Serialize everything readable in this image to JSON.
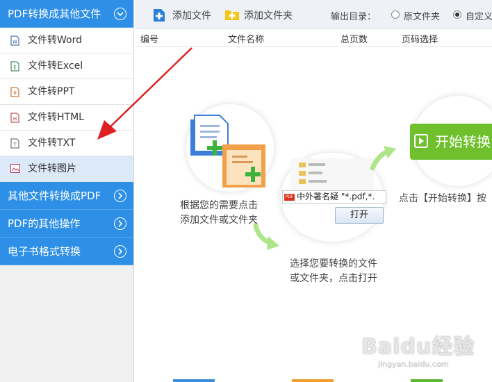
{
  "sidebar": {
    "header1": "PDF转换成其他文件",
    "items": [
      {
        "label": "文件转Word",
        "icon": "word-file-icon",
        "color": "#2b5797",
        "letter": "W"
      },
      {
        "label": "文件转Excel",
        "icon": "excel-file-icon",
        "color": "#217346",
        "letter": "E"
      },
      {
        "label": "文件转PPT",
        "icon": "ppt-file-icon",
        "color": "#c55a11",
        "letter": "P"
      },
      {
        "label": "文件转HTML",
        "icon": "html-file-icon",
        "color": "#a33",
        "letter": "H"
      },
      {
        "label": "文件转TXT",
        "icon": "txt-file-icon",
        "color": "#555",
        "letter": "T"
      },
      {
        "label": "文件转图片",
        "icon": "image-file-icon",
        "color": "#c03060",
        "letter": ""
      }
    ],
    "header2": "其他文件转换成PDF",
    "header3": "PDF的其他操作",
    "header4": "电子书格式转换"
  },
  "toolbar": {
    "add_file": "添加文件",
    "add_folder": "添加文件夹",
    "output_label": "输出目录：",
    "radio_original": "原文件夹",
    "radio_custom": "自定义"
  },
  "table": {
    "columns": [
      "编号",
      "文件名称",
      "总页数",
      "页码选择"
    ]
  },
  "guide": {
    "step1": [
      "根据您的需要点击",
      "添加文件或文件夹"
    ],
    "step2": [
      "选择您要转换的文件",
      "或文件夹，点击打开"
    ],
    "step3": "点击【开始转换】按",
    "start_label": "开始转换",
    "dialog_filename": "中外著名疑 \"*.pdf,*.",
    "dialog_pdf_badge": "PDF",
    "open_label": "打开"
  },
  "watermark": {
    "main": "Baidu经验",
    "sub": "jingyan.baidu.com"
  },
  "colors": {
    "accent": "#2e8fe6",
    "start_green": "#6fc02c",
    "annotation_arrow": "#e02020"
  }
}
